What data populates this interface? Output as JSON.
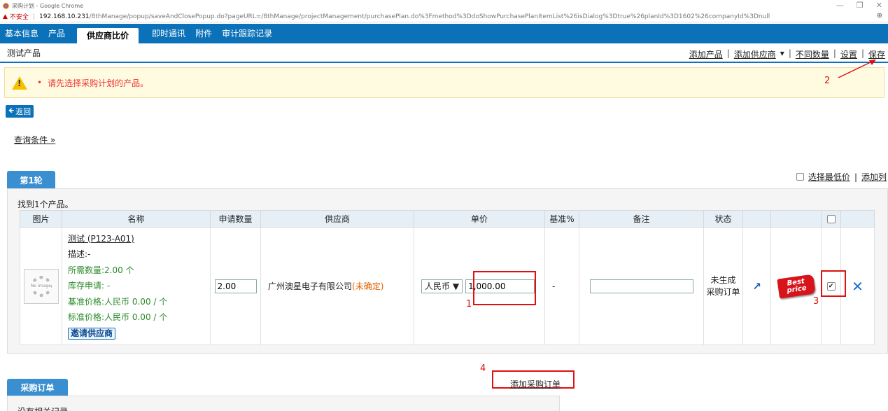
{
  "window": {
    "title": "采购计划 - Google Chrome",
    "controls": [
      "—",
      "❐",
      "✕"
    ]
  },
  "address": {
    "insecure": "不安全",
    "host": "192.168.10.231",
    "path": "/8thManage/popup/saveAndClosePopup.do?pageURL=/8thManage/projectManagement/purchasePlan.do%3Fmethod%3DdoShowPurchasePlanItemList%26isDialog%3Dtrue%26planId%3D1602%26companyId%3Dnull"
  },
  "tabs": [
    "基本信息",
    "产品",
    "供应商比价",
    "即时通讯",
    "附件",
    "审计跟踪记录"
  ],
  "subheader": {
    "title": "测试产品",
    "add_product": "添加产品",
    "add_supplier": "添加供应商",
    "diff_qty": "不同数量",
    "settings": "设置",
    "save": "保存"
  },
  "alert": {
    "message": "请先选择采购计划的产品。"
  },
  "back": "返回",
  "query": "查询条件 »",
  "round": "第1轮",
  "options": {
    "select_lowest": "选择最低价",
    "add_column": "添加列"
  },
  "found": "找到1个产品。",
  "columns": [
    "图片",
    "名称",
    "申请数量",
    "供应商",
    "单价",
    "基准%",
    "备注",
    "状态"
  ],
  "product": {
    "image_text": "No Image",
    "name": "测试 (P123-A01)",
    "desc": "描述:-",
    "required_qty": "所需数量:2.00 个",
    "stock_request": "库存申请: -",
    "base_price": "基准价格:人民币 0.00  / 个",
    "std_price": "标准价格:人民币 0.00  / 个",
    "invite": "邀请供应商",
    "apply_qty": "2.00",
    "supplier": "广州澳星电子有限公司",
    "supplier_status": "(未确定)",
    "currency": "人民币",
    "unit_price": "1,000.00",
    "baseline": "-",
    "status": "未生成\n采购订单",
    "best_tag_1": "Best",
    "best_tag_2": "price"
  },
  "annotations": {
    "n1": "1",
    "n2": "2",
    "n3": "3",
    "n4": "4"
  },
  "add_order": "添加采购订单",
  "order_tab": "采购订单",
  "no_records": "没有相关记录"
}
